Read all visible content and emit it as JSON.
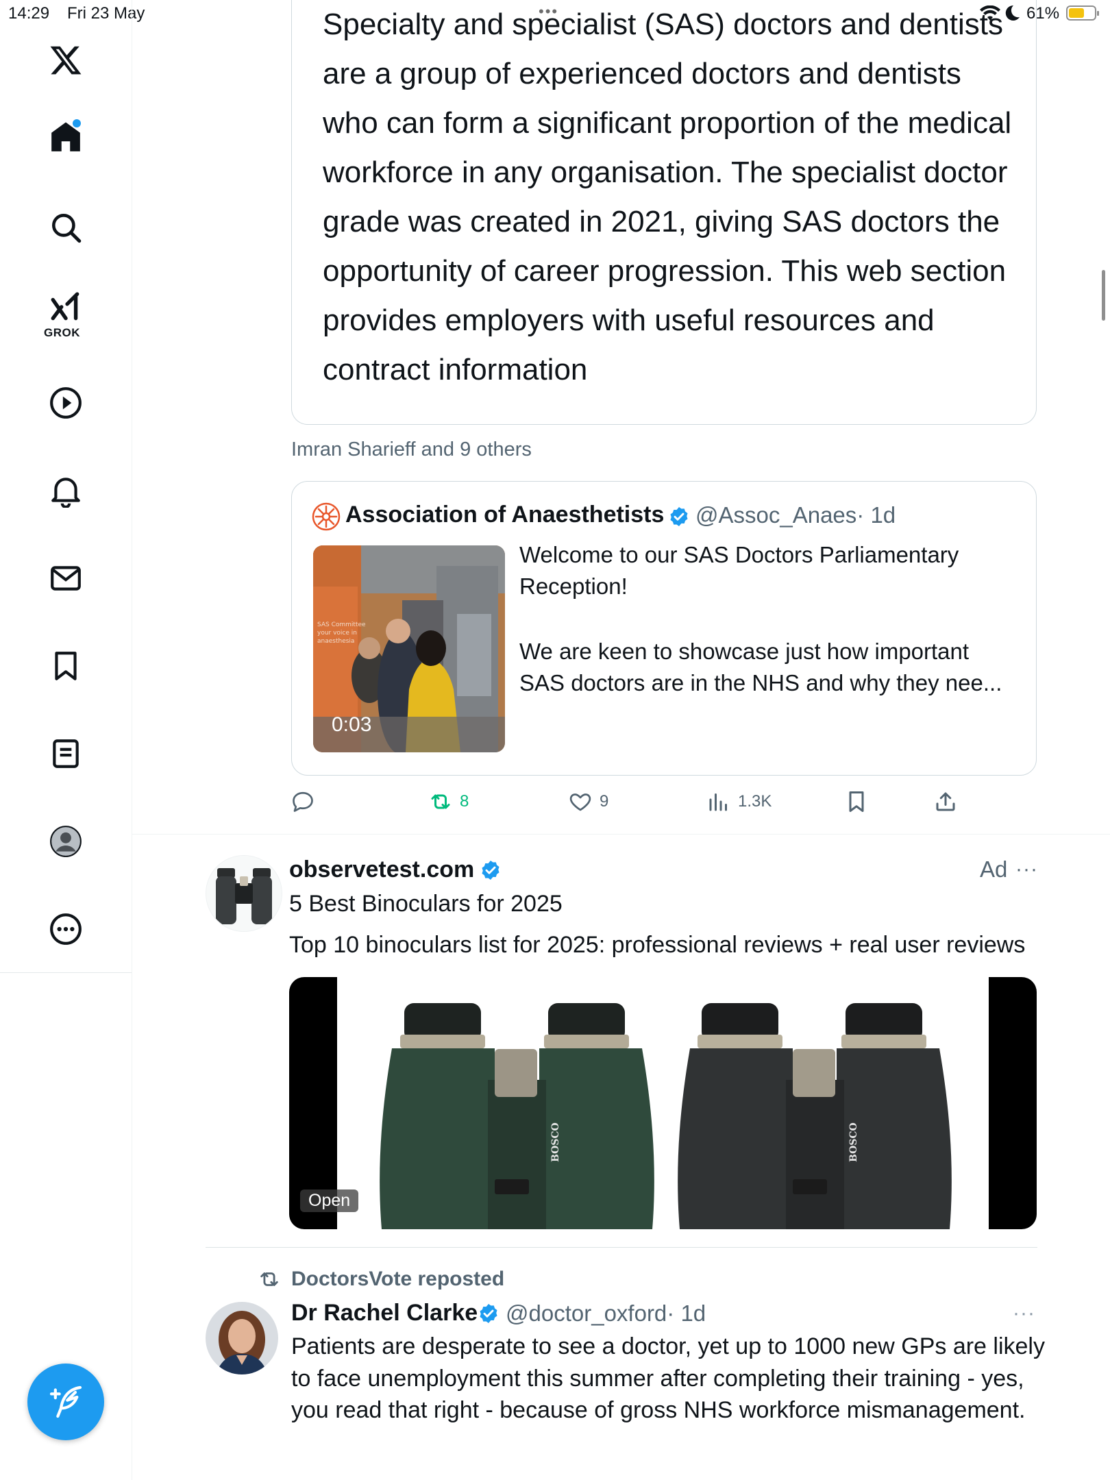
{
  "status_bar": {
    "time": "14:29",
    "date": "Fri 23 May",
    "battery": "61%",
    "battery_level": 0.61,
    "battery_color": "#f4c20d"
  },
  "sidebar": {
    "items": [
      {
        "name": "x-logo-icon"
      },
      {
        "name": "home-icon"
      },
      {
        "name": "search-icon"
      },
      {
        "name": "grok-icon",
        "label": "GROK"
      },
      {
        "name": "video-icon"
      },
      {
        "name": "notifications-icon"
      },
      {
        "name": "messages-icon"
      },
      {
        "name": "bookmarks-icon"
      },
      {
        "name": "lists-icon"
      },
      {
        "name": "profile-icon"
      },
      {
        "name": "more-icon"
      }
    ],
    "accent": "#1d9bf0"
  },
  "feed": {
    "link_card": {
      "description": "Specialty and specialist (SAS) doctors and dentists are a group of experienced doctors and dentists who can form a significant proportion of the medical workforce in any organisation. The specialist doctor grade was created in 2021, giving SAS doctors the opportunity of career progression. This web section provides employers with useful resources and contract information"
    },
    "social_context": "Imran Sharieff and 9 others",
    "quoted_tweet": {
      "author": "Association of Anaesthetists",
      "handle": "@Assoc_Anaes",
      "time": "· 1d",
      "video_duration": "0:03",
      "text1": "Welcome to our SAS Doctors Parliamentary Reception!",
      "text2": "We are keen to showcase just how important SAS doctors are in the NHS and why they nee..."
    },
    "actions": {
      "replies": "",
      "retweets": "8",
      "likes": "9",
      "views": "1.3K"
    },
    "ad": {
      "name": "observetest.com",
      "label": "Ad",
      "more": "···",
      "headline": "5 Best Binoculars for 2025",
      "description": "Top 10 binoculars list for 2025: professional reviews + real user reviews",
      "open_label": "Open",
      "product_brand": "BOSCO"
    },
    "retweeted_post": {
      "repost_label": "DoctorsVote reposted",
      "author": "Dr Rachel Clarke",
      "handle": "@doctor_oxford",
      "time": "· 1d",
      "more": "···",
      "text": "Patients are desperate to see a doctor, yet up to 1000 new GPs are likely to face unemployment this summer after completing their training - yes, you read that right - because of gross NHS workforce mismanagement."
    }
  }
}
